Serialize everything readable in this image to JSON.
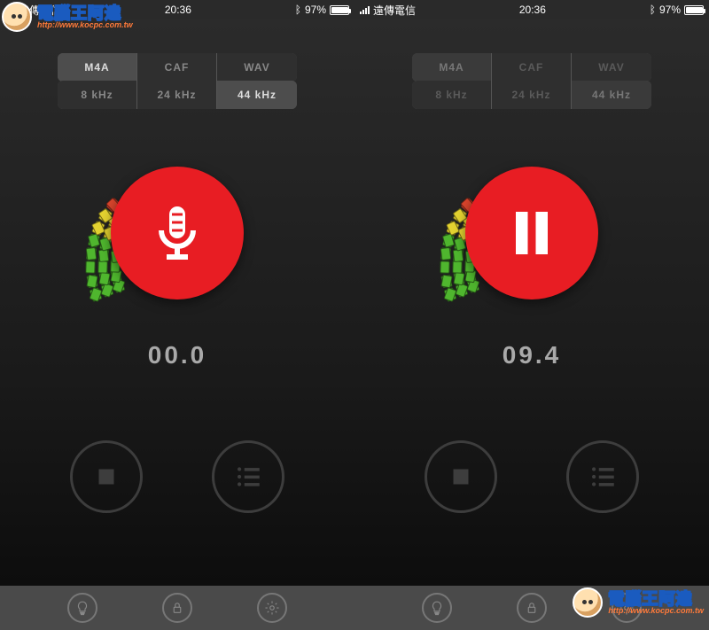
{
  "watermark": {
    "title": "電腦王阿達",
    "url": "http://www.kocpc.com.tw"
  },
  "screens": [
    {
      "status": {
        "carrier": "遠傳電信",
        "time": "20:36",
        "battery_pct": "97%"
      },
      "format_options": [
        "M4A",
        "CAF",
        "WAV"
      ],
      "format_selected": 0,
      "rate_options": [
        "8 kHz",
        "24 kHz",
        "44 kHz"
      ],
      "rate_selected": 2,
      "main_button_icon": "microphone",
      "timer": "00.0",
      "segments_dim": false
    },
    {
      "status": {
        "carrier": "遠傳電信",
        "time": "20:36",
        "battery_pct": "97%"
      },
      "format_options": [
        "M4A",
        "CAF",
        "WAV"
      ],
      "format_selected": 0,
      "rate_options": [
        "8 kHz",
        "24 kHz",
        "44 kHz"
      ],
      "rate_selected": 2,
      "main_button_icon": "pause",
      "timer": "09.4",
      "segments_dim": true
    }
  ],
  "bottom_icons": [
    "tip-icon",
    "lock-icon",
    "settings-icon"
  ]
}
